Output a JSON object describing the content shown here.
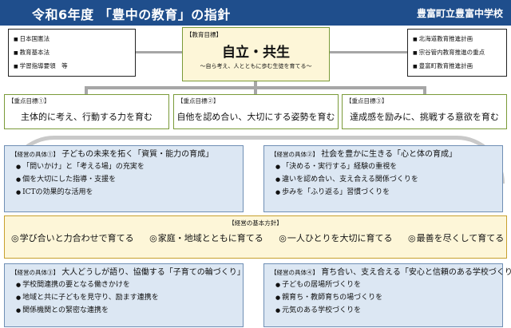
{
  "header": {
    "title": "令和6年度 「豊中の教育」の指針",
    "school": "豊富町立豊富中学校"
  },
  "side_left": {
    "items": [
      "日本国憲法",
      "教育基本法",
      "学習指導要領　等"
    ]
  },
  "side_right": {
    "items": [
      "北海道教育推進計画",
      "宗谷管内教育推進の重点",
      "豊富町教育推進計画"
    ]
  },
  "goal": {
    "label": "【教育目標】",
    "main": "自立・共生",
    "sub": "～自ら考え、人とともに歩む生徒を育てる～"
  },
  "focus": [
    {
      "label": "【重点目標①】",
      "text": "主体的に考え、行動する力を育む"
    },
    {
      "label": "【重点目標②】",
      "text": "自他を認め合い、大切にする姿勢を育む"
    },
    {
      "label": "【重点目標③】",
      "text": "達成感を励みに、挑戦する意欲を育む"
    }
  ],
  "management": [
    {
      "tag": "【経営の具体①】",
      "title": "子どもの未来を拓く「資質・能力の育成」",
      "bullets": [
        "「問いかけ」と「考える場」の充実を",
        "個を大切にした指導・支援を",
        "ICTの効果的な活用を"
      ]
    },
    {
      "tag": "【経営の具体②】",
      "title": "社会を豊かに生きる「心と体の育成」",
      "bullets": [
        "「決める・実行する」経験の重視を",
        "違いを認め合い、支え合える関係づくりを",
        "歩みを「ふり返る」習慣づくりを"
      ]
    },
    {
      "tag": "【経営の具体③】",
      "title": "大人どうしが語り、協働する「子育ての輪づくり」",
      "bullets": [
        "学校間連携の要となる働きかけを",
        "地域と共に子どもを見守り、励ます連携を",
        "関係機関との緊密な連携を"
      ]
    },
    {
      "tag": "【経営の具体④】",
      "title": "育ち合い、支え合える「安心と信頼のある学校づくり」",
      "bullets": [
        "子どもの居場所づくりを",
        "親育ち・教師育ちの場づくりを",
        "元気のある学校づくりを"
      ]
    }
  ],
  "policy": {
    "label": "【経営の基本方針】",
    "items": [
      "学び合いと力合わせで育てる",
      "家庭・地域とともに育てる",
      "一人ひとりを大切に育てる",
      "最善を尽くして育てる"
    ]
  },
  "colors": {
    "header_bg": "#1f4e8c",
    "highlight_purple": "#7b3fa0",
    "goal_bg": "#fdf6d8",
    "management_bg": "#dce7f3"
  }
}
